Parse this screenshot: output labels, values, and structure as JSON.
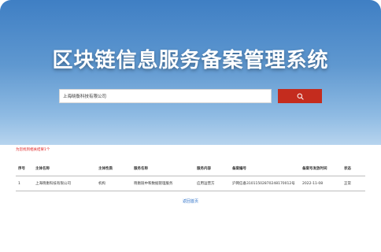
{
  "banner": {
    "title": "区块链信息服务备案管理系统"
  },
  "search": {
    "value": "上海晓衡科技有限公司",
    "button_icon": "search-icon"
  },
  "result_note": "为您找到相关结果1个",
  "table": {
    "headers": [
      "序号",
      "主体名称",
      "主体性质",
      "服务名称",
      "服务内容",
      "备案编号",
      "备案号发放时间",
      "状态"
    ],
    "rows": [
      [
        "1",
        "上海晓衡科技有限公司",
        "机构",
        "晓衡链中和数据管理服务",
        "应用运营方",
        "沪网信备31011502870248170012号",
        "2022-11-08",
        "正常"
      ]
    ]
  },
  "back_link": "返回首页",
  "colors": {
    "banner_top": "#3f7fc4",
    "banner_bottom": "#b7d4ee",
    "search_button": "#c42c1e",
    "result_note": "#e02020",
    "link": "#2a6fc7"
  }
}
